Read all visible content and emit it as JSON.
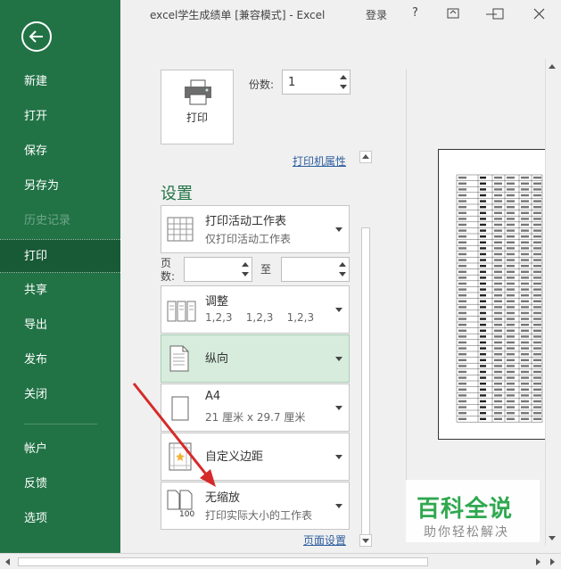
{
  "window": {
    "title": "excel学生成绩单  [兼容模式]  -  Excel",
    "login": "登录",
    "help": "?"
  },
  "sidebar": {
    "items": [
      {
        "label": "新建"
      },
      {
        "label": "打开"
      },
      {
        "label": "保存"
      },
      {
        "label": "另存为"
      },
      {
        "label": "历史记录"
      },
      {
        "label": "打印"
      },
      {
        "label": "共享"
      },
      {
        "label": "导出"
      },
      {
        "label": "发布"
      },
      {
        "label": "关闭"
      },
      {
        "label": "帐户"
      },
      {
        "label": "反馈"
      },
      {
        "label": "选项"
      }
    ]
  },
  "print": {
    "button_label": "打印",
    "copies_label": "份数:",
    "copies_value": "1",
    "printer_properties": "打印机属性"
  },
  "settings": {
    "title": "设置",
    "print_what": {
      "title": "打印活动工作表",
      "subtitle": "仅打印活动工作表"
    },
    "pages_label": "页数:",
    "pages_from": "",
    "to_label": "至",
    "pages_to": "",
    "collate": {
      "title": "调整",
      "subtitle": "1,2,3    1,2,3    1,2,3"
    },
    "orientation": {
      "title": "纵向"
    },
    "paper": {
      "title": "A4",
      "subtitle": "21 厘米 x 29.7 厘米"
    },
    "margins": {
      "title": "自定义边距"
    },
    "scaling": {
      "title": "无缩放",
      "subtitle": "打印实际大小的工作表",
      "icon_number": "100"
    },
    "page_setup": "页面设置"
  },
  "watermark": {
    "text": "百科全说",
    "subtext": "助你轻松解决"
  },
  "colors": {
    "sidebar": "#217346",
    "active": "#195a36",
    "accent": "#217346",
    "link": "#2e5e9e",
    "annotation_arrow": "#d62a2a"
  }
}
